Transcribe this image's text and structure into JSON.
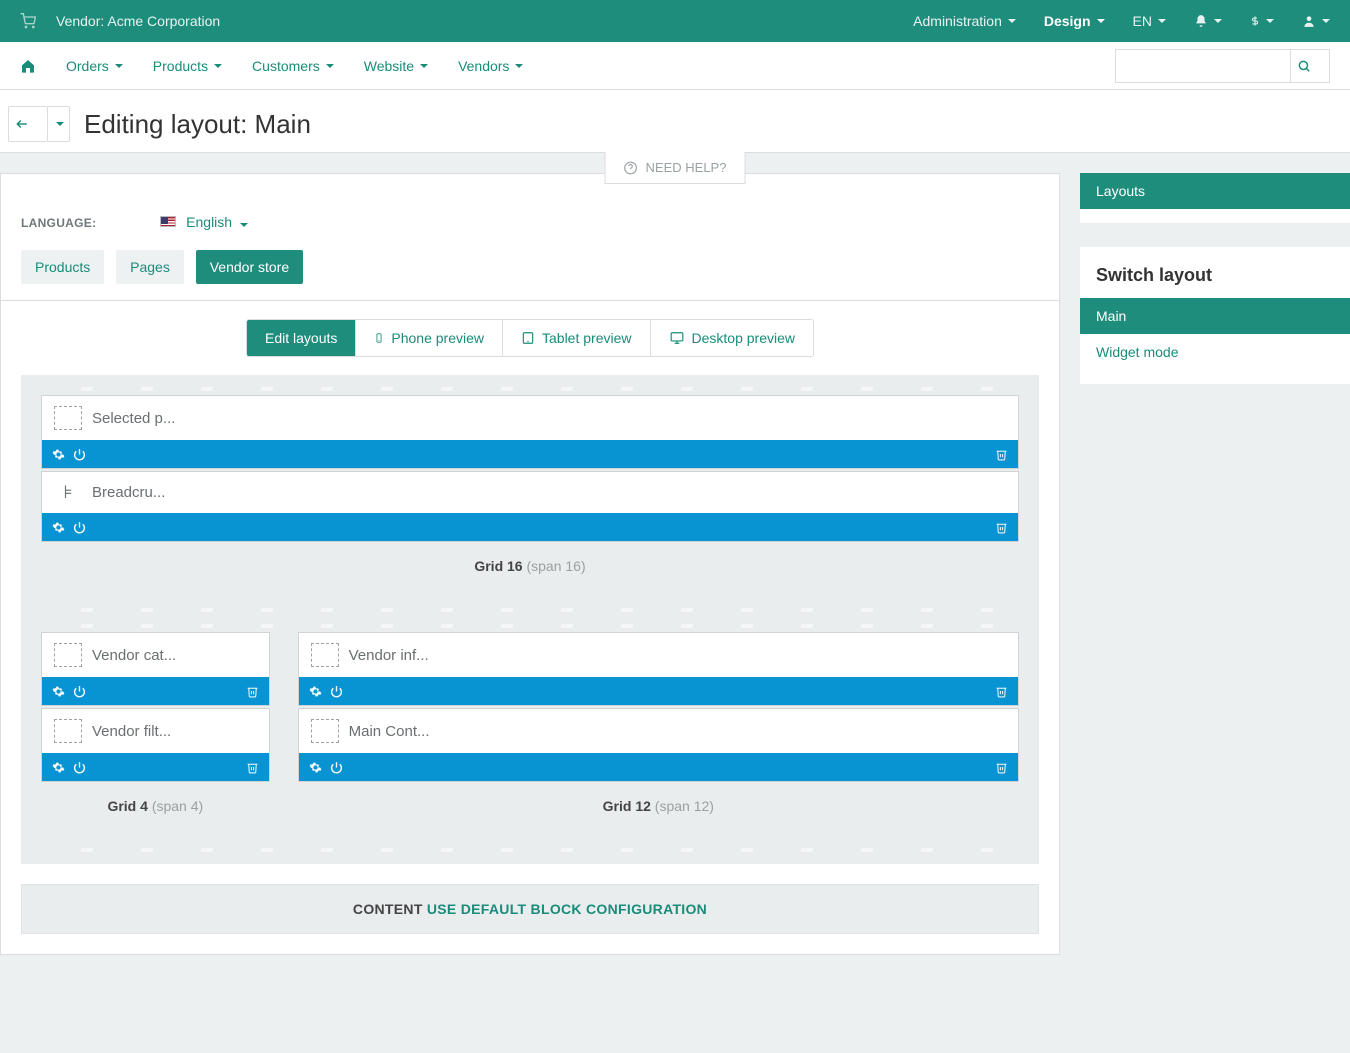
{
  "topbar": {
    "vendor_label": "Vendor: Acme Corporation",
    "menus": {
      "admin": "Administration",
      "design": "Design",
      "lang": "EN"
    }
  },
  "mainnav": {
    "items": [
      "Orders",
      "Products",
      "Customers",
      "Website",
      "Vendors"
    ]
  },
  "title": "Editing layout: Main",
  "need_help": "NEED HELP?",
  "language": {
    "label": "LANGUAGE:",
    "value": "English"
  },
  "tabs": [
    "Products",
    "Pages",
    "Vendor store"
  ],
  "preview": [
    "Edit layouts",
    "Phone preview",
    "Tablet preview",
    "Desktop preview"
  ],
  "blocks": {
    "top": [
      {
        "name": "Selected p...",
        "icon": "box"
      },
      {
        "name": "Breadcru...",
        "icon": "bc"
      }
    ],
    "grid16": {
      "label": "Grid 16",
      "span": "(span 16)"
    },
    "left": [
      {
        "name": "Vendor cat...",
        "icon": "box"
      },
      {
        "name": "Vendor filt...",
        "icon": "box"
      }
    ],
    "right": [
      {
        "name": "Vendor inf...",
        "icon": "box"
      },
      {
        "name": "Main Cont...",
        "icon": "box"
      }
    ],
    "grid4": {
      "label": "Grid 4",
      "span": "(span 4)"
    },
    "grid12": {
      "label": "Grid 12",
      "span": "(span 12)"
    }
  },
  "content_footer": {
    "left": "CONTENT",
    "right": "USE DEFAULT BLOCK CONFIGURATION"
  },
  "sidebar": {
    "layouts_head": "Layouts",
    "switch_title": "Switch layout",
    "items": [
      "Main",
      "Widget mode"
    ]
  }
}
